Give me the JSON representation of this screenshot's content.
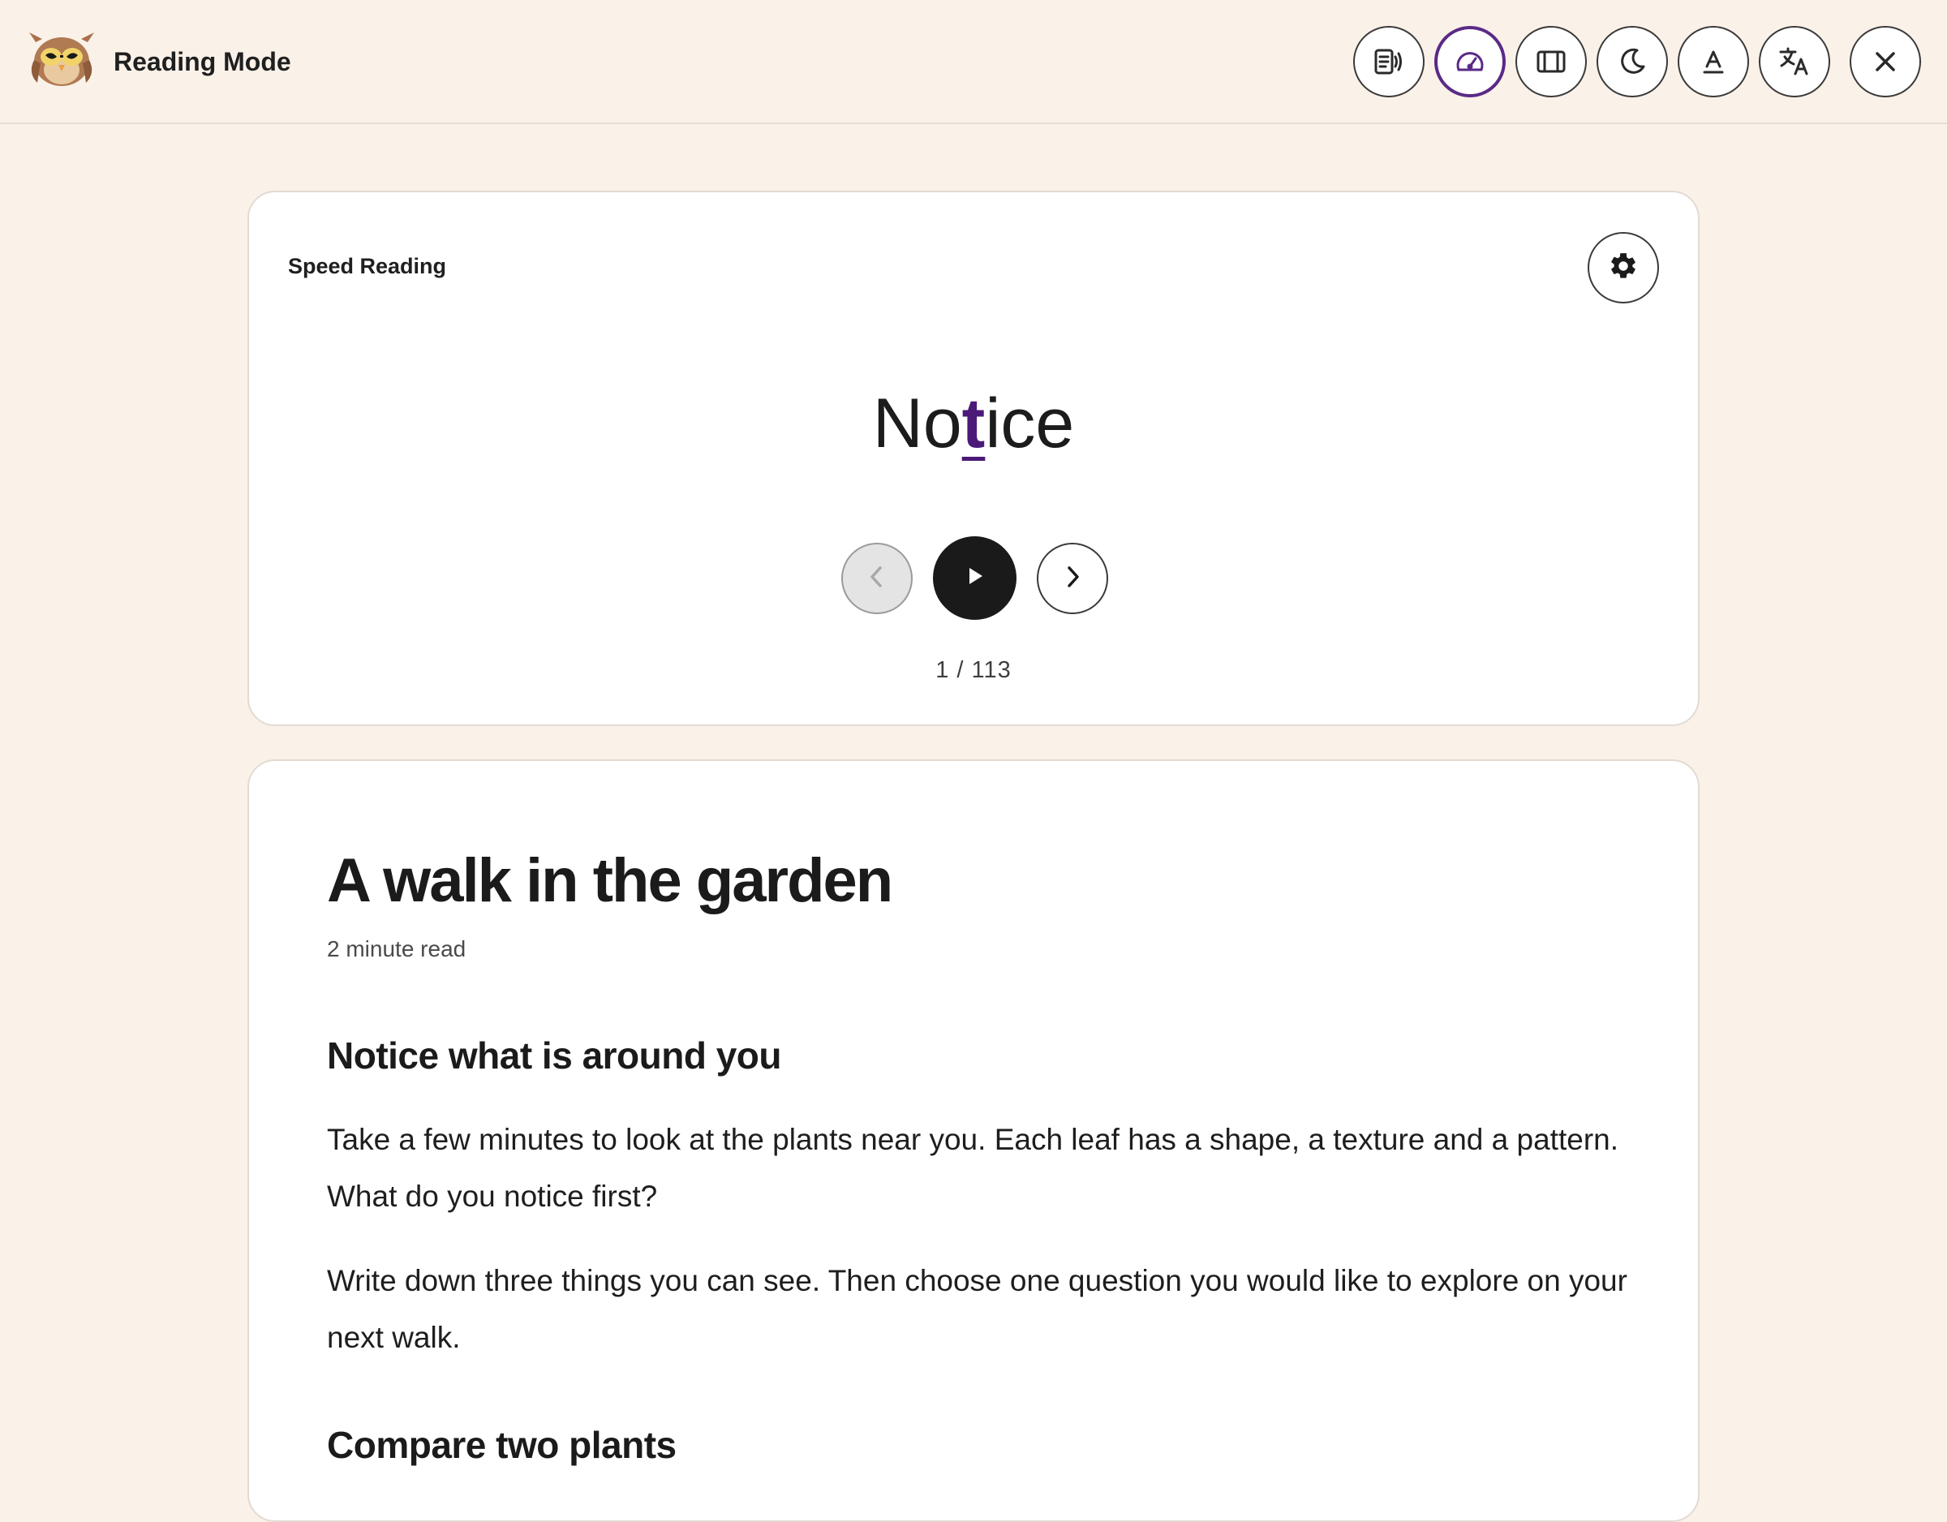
{
  "header": {
    "title": "Reading Mode",
    "logo_icon": "owl-logo-icon",
    "tools": [
      {
        "name": "read-aloud",
        "icon": "read-aloud-icon"
      },
      {
        "name": "speed-reading",
        "icon": "speedometer-icon",
        "active": true
      },
      {
        "name": "focus-ruler",
        "icon": "ruler-panel-icon"
      },
      {
        "name": "dark-mode",
        "icon": "moon-icon"
      },
      {
        "name": "text-style",
        "icon": "text-format-icon"
      },
      {
        "name": "translate",
        "icon": "translate-icon"
      },
      {
        "name": "close",
        "icon": "close-icon"
      }
    ]
  },
  "speed_reader": {
    "label": "Speed Reading",
    "word_before": "No",
    "word_focus": "t",
    "word_after": "ice",
    "progress_text": "1 / 113",
    "current_index": 1,
    "total_words": 113,
    "accent_color": "#4b1a78"
  },
  "article": {
    "title": "A walk in the garden",
    "read_time": "2 minute read",
    "section_1_heading": "Notice what is around you",
    "paragraph_1": "Take a few minutes to look at the plants near you. Each leaf has a shape, a texture and a pattern. What do you notice first?",
    "paragraph_2": "Write down three things you can see. Then choose one question you would like to explore on your next walk.",
    "section_2_heading": "Compare two plants"
  }
}
